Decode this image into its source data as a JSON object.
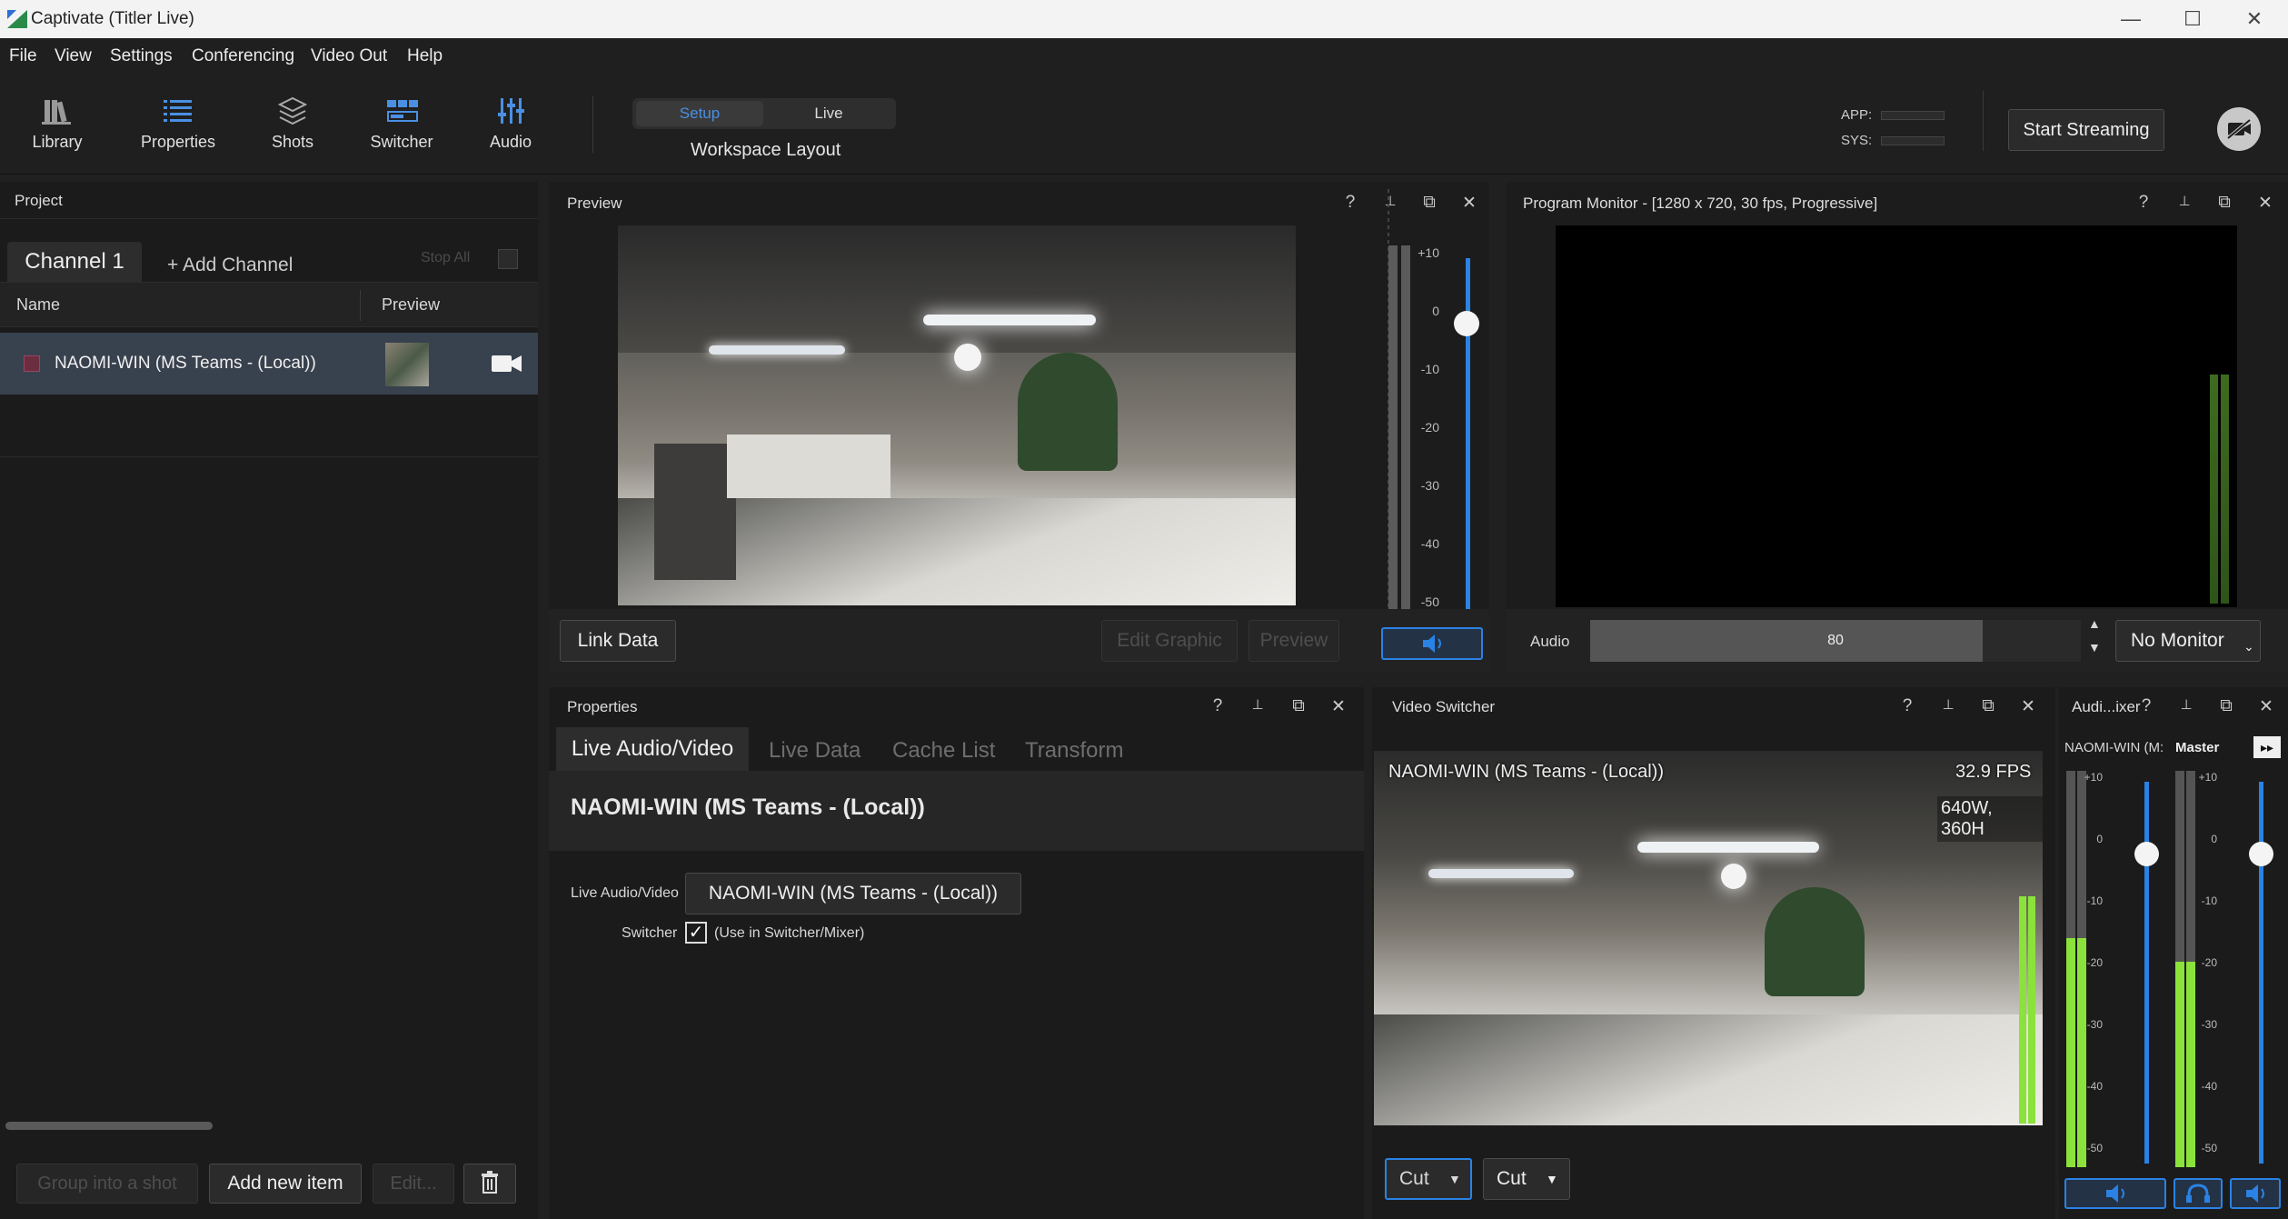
{
  "window": {
    "title": "Captivate (Titler Live)",
    "minimize": "—",
    "maximize": "☐",
    "close": "✕"
  },
  "menu": [
    "File",
    "View",
    "Settings",
    "Conferencing",
    "Video Out",
    "Help"
  ],
  "toolbar": {
    "tools": [
      {
        "label": "Library",
        "icon": "library-icon"
      },
      {
        "label": "Properties",
        "icon": "properties-icon"
      },
      {
        "label": "Shots",
        "icon": "shots-icon"
      },
      {
        "label": "Switcher",
        "icon": "switcher-icon"
      },
      {
        "label": "Audio",
        "icon": "audio-icon"
      }
    ],
    "mode_setup": "Setup",
    "mode_live": "Live",
    "workspace_label": "Workspace Layout",
    "app_label": "APP:",
    "sys_label": "SYS:",
    "start_streaming": "Start Streaming",
    "accent": "#4a90e2"
  },
  "project": {
    "title": "Project",
    "channel_tab": "Channel 1",
    "add_channel": "+ Add Channel",
    "stop_all": "Stop All",
    "col_name": "Name",
    "col_preview": "Preview",
    "items": [
      {
        "name": "NAOMI-WIN (MS Teams - (Local))"
      }
    ],
    "group_into_shot": "Group into a shot",
    "add_new_item": "Add new item",
    "edit": "Edit..."
  },
  "preview_panel": {
    "title": "Preview",
    "link_data": "Link Data",
    "edit_graphic": "Edit Graphic",
    "preview_btn": "Preview",
    "help": "?",
    "pin": "📌",
    "float": "⧉",
    "close": "✕"
  },
  "meter_ticks": [
    "+10",
    "0",
    "-10",
    "-20",
    "-30",
    "-40",
    "-50"
  ],
  "program_monitor": {
    "title": "Program Monitor - [1280 x 720, 30 fps, Progressive]",
    "audio_label": "Audio",
    "audio_value": "80",
    "audio_level": 0.8,
    "no_monitor": "No Monitor"
  },
  "properties_panel": {
    "title": "Properties",
    "tabs": [
      "Live Audio/Video",
      "Live Data",
      "Cache List",
      "Transform"
    ],
    "heading": "NAOMI-WIN (MS Teams - (Local))",
    "field_label": "Live Audio/Video",
    "field_value": "NAOMI-WIN (MS Teams - (Local))",
    "switcher_label": "Switcher",
    "switcher_check_label": "(Use in Switcher/Mixer)"
  },
  "video_switcher": {
    "title": "Video Switcher",
    "source_name": "NAOMI-WIN (MS Teams - (Local))",
    "fps": "32.9 FPS",
    "resolution": "640W, 360H",
    "transition_1": "Cut",
    "transition_2": "Cut"
  },
  "audio_mixer": {
    "title": "Audi...ixer",
    "channel_name": "NAOMI-WIN (M:",
    "master_label": "Master",
    "expand": "▸▸"
  }
}
